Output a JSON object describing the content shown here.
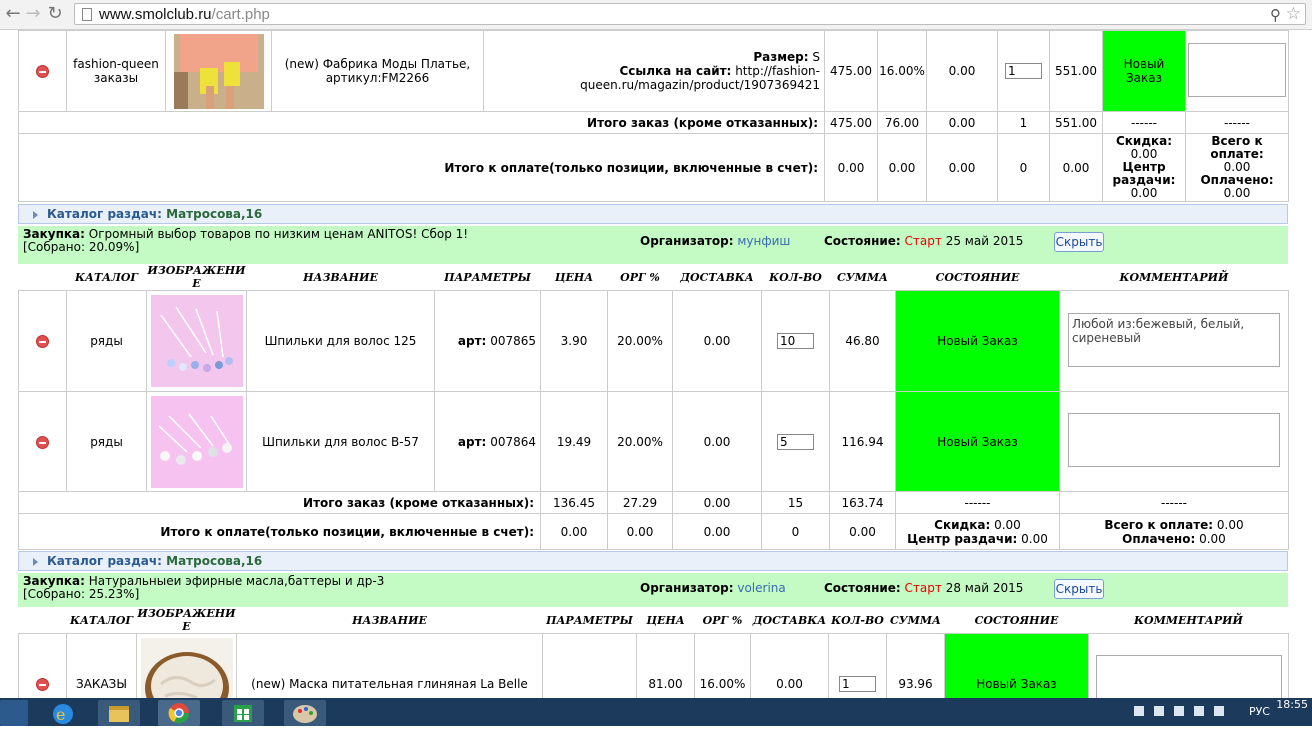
{
  "browser": {
    "url_host": "www.smolclub.ru",
    "url_path": "/cart.php"
  },
  "block1": {
    "row": {
      "catalog": "fashion-queen заказы",
      "name": "(new) Фабрика Моды Платье, артикул:FM2266",
      "params_size_label": "Размер:",
      "params_size": "S",
      "params_link_label": "Ссылка на сайт:",
      "params_link": "http://fashion-queen.ru/magazin/product/1907369421",
      "price": "475.00",
      "org": "16.00%",
      "delivery": "0.00",
      "qty": "1",
      "sum": "551.00",
      "status": "Новый Заказ",
      "comment": ""
    },
    "total_order": {
      "label": "Итого заказ (кроме отказанных):",
      "price": "475.00",
      "org": "76.00",
      "delivery": "0.00",
      "qty": "1",
      "sum": "551.00",
      "status": "------",
      "comment": "------"
    },
    "total_pay": {
      "label": "Итого к оплате(только позиции, включенные в счет):",
      "price": "0.00",
      "org": "0.00",
      "delivery": "0.00",
      "qty": "0",
      "sum": "0.00",
      "discount_label": "Скидка:",
      "discount": "0.00",
      "center_label": "Центр раздачи:",
      "center": "0.00",
      "all_label": "Всего к оплате:",
      "all": "0.00",
      "paid_label": "Оплачено:",
      "paid": "0.00"
    }
  },
  "catalog1": {
    "label": "Каталог раздач:",
    "location": "Матросова,16"
  },
  "purchase1": {
    "label": "Закупка:",
    "title": "Огромный выбор товаров по низким ценам ANITOS! Сбор 1!",
    "collected": "[Собрано: 20.09%]",
    "org_label": "Организатор:",
    "org": "мунфиш",
    "state_label": "Состояние:",
    "state": "Старт",
    "date": "25 май 2015",
    "hide": "Скрыть"
  },
  "headers": {
    "catalog": "КАТАЛОГ",
    "image": "ИЗОБРАЖЕНИЕ",
    "name": "НАЗВАНИЕ",
    "params": "ПАРАМЕТРЫ",
    "price": "ЦЕНА",
    "org": "ОРГ %",
    "delivery": "ДОСТАВКА",
    "qty": "КОЛ-ВО",
    "sum": "СУММА",
    "status": "СОСТОЯНИЕ",
    "comment": "КОММЕНТАРИЙ"
  },
  "block2": {
    "rows": [
      {
        "catalog": "ряды",
        "name": "Шпильки для волос 125",
        "param_label": "арт:",
        "param": "007865",
        "price": "3.90",
        "org": "20.00%",
        "delivery": "0.00",
        "qty": "10",
        "sum": "46.80",
        "status": "Новый Заказ",
        "comment": "Любой из:бежевый, белый, сиреневый"
      },
      {
        "catalog": "ряды",
        "name": "Шпильки для волос В-57",
        "param_label": "арт:",
        "param": "007864",
        "price": "19.49",
        "org": "20.00%",
        "delivery": "0.00",
        "qty": "5",
        "sum": "116.94",
        "status": "Новый Заказ",
        "comment": ""
      }
    ],
    "total_order": {
      "label": "Итого заказ (кроме отказанных):",
      "price": "136.45",
      "org": "27.29",
      "delivery": "0.00",
      "qty": "15",
      "sum": "163.74",
      "status": "------",
      "comment": "------"
    },
    "total_pay": {
      "label": "Итого к оплате(только позиции, включенные в счет):",
      "price": "0.00",
      "org": "0.00",
      "delivery": "0.00",
      "qty": "0",
      "sum": "0.00",
      "discount_label": "Скидка:",
      "discount": "0.00",
      "center_label": "Центр раздачи:",
      "center": "0.00",
      "all_label": "Всего к оплате:",
      "all": "0.00",
      "paid_label": "Оплачено:",
      "paid": "0.00"
    }
  },
  "catalog2": {
    "label": "Каталог раздач:",
    "location": "Матросова,16"
  },
  "purchase2": {
    "label": "Закупка:",
    "title": "Натуральныеи эфирные масла,баттеры и др-3",
    "collected": "[Собрано: 25.23%]",
    "org_label": "Организатор:",
    "org": "volerina",
    "state_label": "Состояние:",
    "state": "Старт",
    "date": "28 май 2015",
    "hide": "Скрыть"
  },
  "block3": {
    "row": {
      "catalog": "ЗАКАЗЫ",
      "name": "(new) Маска питательная глиняная La Belle",
      "params": "",
      "price": "81.00",
      "org": "16.00%",
      "delivery": "0.00",
      "qty": "1",
      "sum": "93.96",
      "status": "Новый Заказ",
      "comment": ""
    }
  },
  "taskbar": {
    "lang": "РУС",
    "time": "18:55"
  },
  "colors": {
    "status_green": "#00ff00",
    "purchase_bg": "#c4fbc4",
    "state_red": "#ee0000",
    "org_link": "#3a6ab0"
  }
}
